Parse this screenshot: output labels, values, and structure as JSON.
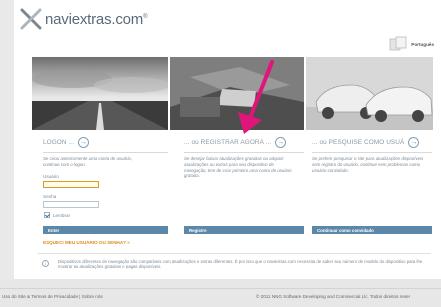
{
  "logo": {
    "name": "naviextras.com",
    "reg": "®"
  },
  "language": {
    "label": "Português"
  },
  "panels": [
    {
      "title": "LOGON ...",
      "description": "Se criou anteriormente uma conta de usuário, continue com o logon.",
      "username_label": "Usuário",
      "password_label": "Senha",
      "remember_label": "Lembrar",
      "button": "Enter"
    },
    {
      "title": "... ou REGISTRAR AGORA ...",
      "description": "Se desejar baixar atualizações gratuitas ou adquirir atualizações ou extras para seu dispositivo de navegação, tem de criar primeiro uma conta de usuário gratuita.",
      "button": "Registre"
    },
    {
      "title": "... ou PESQUISE COMO USUÁ",
      "description": "Se preferir pesquisar o site para atualizações disponíveis sem registro do usuário, continue sem problemas como usuário convidado.",
      "button": "Continuar como convidado"
    }
  ],
  "forgot": "ESQUECI MEU USUÁRIO OU SENHA?",
  "notice": "Dispositivos diferentes de navegação são compatíveis com atualizações e extras diferentes. É por isso que o naviextras.com necessita de saber seu número de modelo do dispositivo para lhe mostrar as atualizações gratuitas e pagas disponíveis.",
  "footer": {
    "left": "Uso do Site & Termos de Privacidade | Sobre nós",
    "right": "© 2011 NNG Software Developing and Commercial Llc. Todos direitos reser"
  },
  "colors": {
    "accent": "#5b87a9",
    "warning": "#e08a1e",
    "pointer": "#e0147a"
  }
}
